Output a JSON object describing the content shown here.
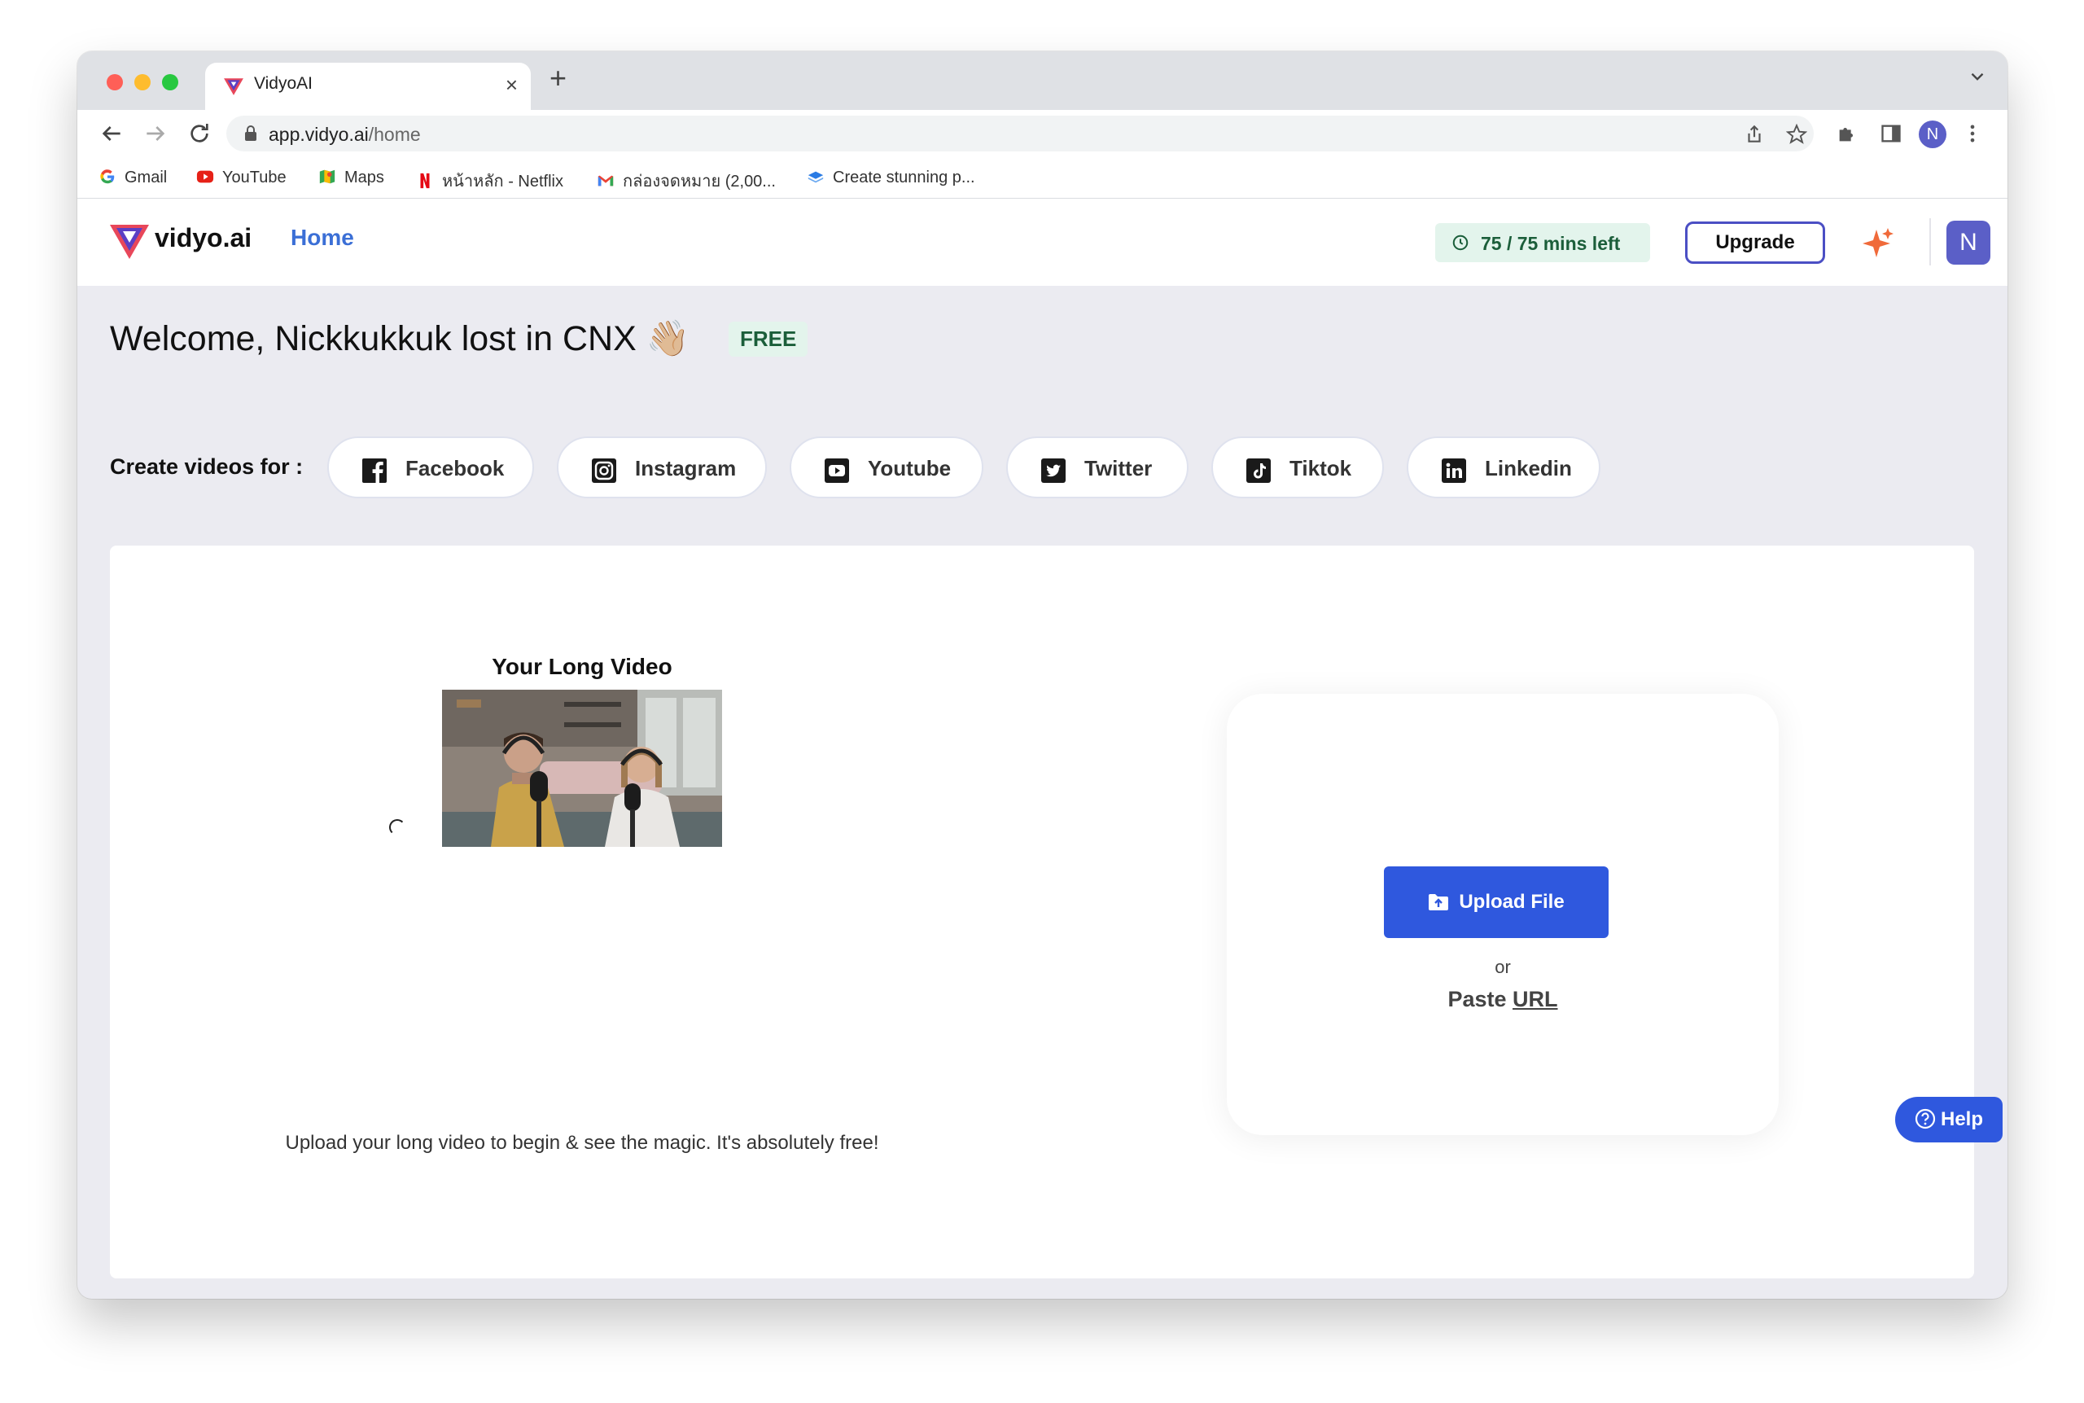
{
  "browser": {
    "tab": {
      "title": "VidyoAI"
    },
    "address": {
      "host": "app.vidyo.ai",
      "path": "/home"
    },
    "profile_initial": "N",
    "bookmarks": [
      {
        "label": "Gmail",
        "icon": "google-icon"
      },
      {
        "label": "YouTube",
        "icon": "youtube-icon"
      },
      {
        "label": "Maps",
        "icon": "maps-icon"
      },
      {
        "label": "หน้าหลัก - Netflix",
        "icon": "netflix-icon"
      },
      {
        "label": "กล่องจดหมาย (2,00...",
        "icon": "gmail-icon"
      },
      {
        "label": "Create stunning p...",
        "icon": "layers-icon"
      }
    ]
  },
  "header": {
    "logo_text": "vidyo.ai",
    "nav_home": "Home",
    "minutes_left": "75 / 75 mins left",
    "upgrade_label": "Upgrade",
    "avatar_initial": "N"
  },
  "welcome": {
    "text": "Welcome, Nickkukkuk lost in CNX 👋🏼",
    "plan_badge": "FREE"
  },
  "platforms": {
    "label": "Create videos for :",
    "items": [
      {
        "label": "Facebook",
        "icon": "facebook-icon"
      },
      {
        "label": "Instagram",
        "icon": "instagram-icon"
      },
      {
        "label": "Youtube",
        "icon": "youtube-icon"
      },
      {
        "label": "Twitter",
        "icon": "twitter-icon"
      },
      {
        "label": "Tiktok",
        "icon": "tiktok-icon"
      },
      {
        "label": "Linkedin",
        "icon": "linkedin-icon"
      }
    ]
  },
  "main": {
    "long_video_title": "Your Long Video",
    "hint": "Upload your long video to begin & see the magic. It's absolutely free!",
    "upload_label": "Upload File",
    "or_label": "or",
    "paste_prefix": "Paste",
    "paste_link": "URL"
  },
  "help": {
    "label": "Help"
  },
  "colors": {
    "brand_blue": "#2f58de",
    "nav_blue": "#3b6fd6",
    "upgrade_border": "#4b4fc4",
    "badge_green_bg": "#e3f4ec",
    "badge_green_text": "#1b5e3a",
    "page_bg": "#ebebf1"
  }
}
